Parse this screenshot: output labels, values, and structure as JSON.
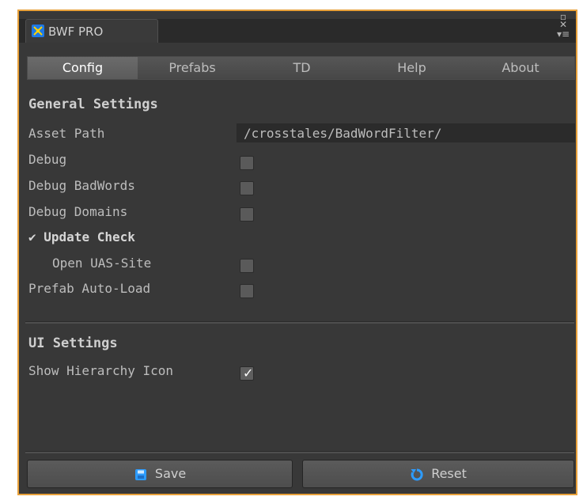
{
  "window": {
    "title": "BWF PRO",
    "window_controls": [
      "minimize-icon",
      "menu-icon"
    ]
  },
  "tabs": [
    "Config",
    "Prefabs",
    "TD",
    "Help",
    "About"
  ],
  "active_tab": "Config",
  "general_settings": {
    "title": "General Settings",
    "asset_path_label": "Asset Path",
    "asset_path_value": "/crosstales/BadWordFilter/",
    "debug_label": "Debug",
    "debug_badwords_label": "Debug BadWords",
    "debug_domains_label": "Debug Domains",
    "update_check_label": "Update Check",
    "open_uas_label": "Open UAS-Site",
    "prefab_autoload_label": "Prefab Auto-Load"
  },
  "ui_settings": {
    "title": "UI Settings",
    "show_hierarchy_icon_label": "Show Hierarchy Icon"
  },
  "state": {
    "debug": false,
    "debug_badwords": false,
    "debug_domains": false,
    "update_check": true,
    "open_uas": false,
    "prefab_autoload": false,
    "show_hierarchy_icon": true
  },
  "buttons": {
    "save": "Save",
    "reset": "Reset"
  },
  "colors": {
    "accent_border": "#e8a13a",
    "panel": "#383838",
    "text": "#bdbdbd",
    "icon_blue": "#2d9cff"
  }
}
